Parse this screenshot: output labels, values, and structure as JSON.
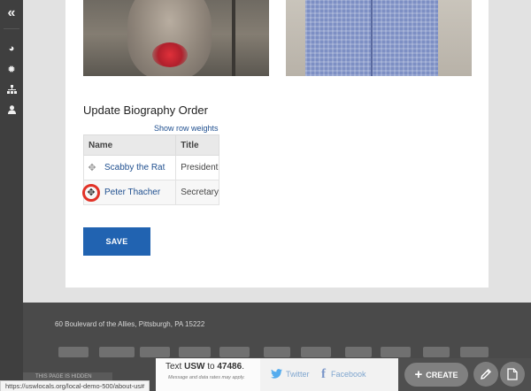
{
  "rail": {
    "collapse_icon": "double-chevron-left",
    "items": [
      {
        "name": "palette-icon",
        "glyph": "◕"
      },
      {
        "name": "gear-icon",
        "glyph": "✹"
      },
      {
        "name": "sitemap-icon",
        "glyph": "⛗"
      },
      {
        "name": "user-icon",
        "glyph": "☗"
      }
    ]
  },
  "biography": {
    "title": "Update Biography Order",
    "weights_link": "Show row weights",
    "columns": [
      "Name",
      "Title"
    ],
    "rows": [
      {
        "name": "Scabby the Rat",
        "title": "President"
      },
      {
        "name": "Peter Thacher",
        "title": "Secretary"
      }
    ],
    "save_label": "SAVE"
  },
  "footer": {
    "address": "60 Boulevard of the Allies, Pittsburgh, PA 15222"
  },
  "cta": {
    "text_prefix": "Text ",
    "keyword": "USW",
    "text_mid": " to ",
    "number": "47486",
    "text_end": ".",
    "disclaimer": "Message and data rates may apply.",
    "hidden_notice": "THIS PAGE IS HIDDEN"
  },
  "social": {
    "twitter_label": "Twitter",
    "facebook_label": "Facebook"
  },
  "editbar": {
    "create_label": "CREATE",
    "edit_icon": "pencil-icon",
    "page_icon": "page-icon"
  },
  "status_url": "https://uswlocals.org/local-demo-500/about-us#",
  "colors": {
    "rail": "#3f3f3f",
    "link": "#1f4f8f",
    "save_button": "#2163b1",
    "footer": "#4a4a4a",
    "highlight_ring": "#e23227"
  }
}
